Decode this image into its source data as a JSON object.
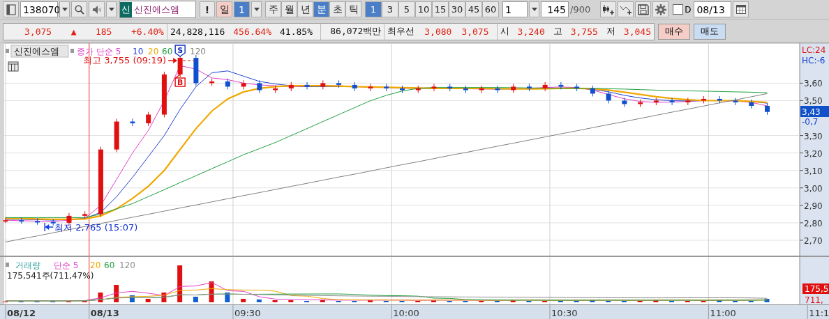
{
  "toolbar": {
    "code": "138070",
    "name_badge": "신",
    "name": "신진에스엠",
    "alert": "!",
    "day_button": {
      "label": "일",
      "active": true
    },
    "day_count": {
      "label": "1",
      "selected": true
    },
    "periods": [
      {
        "label": "주",
        "selected": false
      },
      {
        "label": "월",
        "selected": false
      },
      {
        "label": "년",
        "selected": false
      },
      {
        "label": "분",
        "selected": true
      },
      {
        "label": "초",
        "selected": false
      },
      {
        "label": "틱",
        "selected": false
      }
    ],
    "intervals": [
      {
        "label": "1",
        "selected": true
      },
      {
        "label": "3",
        "selected": false
      },
      {
        "label": "5",
        "selected": false
      },
      {
        "label": "10",
        "selected": false
      },
      {
        "label": "15",
        "selected": false
      },
      {
        "label": "30",
        "selected": false
      },
      {
        "label": "45",
        "selected": false
      },
      {
        "label": "60",
        "selected": false
      }
    ],
    "count_field": "1",
    "range_field": "145",
    "range_total": "/900",
    "checkbox": {
      "label": "D",
      "checked": false
    },
    "date": "08/13"
  },
  "quote": {
    "groups": [
      [
        {
          "text": "3,075",
          "kind": "up"
        },
        {
          "text": "▲",
          "kind": "up"
        },
        {
          "text": "185",
          "kind": "up"
        },
        {
          "text": "+6.40%",
          "kind": "up"
        }
      ],
      [
        {
          "text": "24,828,116",
          "kind": "plain"
        },
        {
          "text": "456.64%",
          "kind": "up"
        },
        {
          "text": "41.85%",
          "kind": "plain"
        }
      ],
      [
        {
          "text": "86,072백만",
          "kind": "plain"
        }
      ],
      [
        {
          "text": "최우선",
          "kind": "label"
        },
        {
          "text": "3,080",
          "kind": "up"
        },
        {
          "text": "3,075",
          "kind": "up"
        }
      ],
      [
        {
          "text": "시",
          "kind": "label"
        },
        {
          "text": "3,240",
          "kind": "up"
        },
        {
          "text": "고",
          "kind": "label"
        },
        {
          "text": "3,755",
          "kind": "up"
        },
        {
          "text": "저",
          "kind": "label"
        },
        {
          "text": "3,045",
          "kind": "up"
        }
      ]
    ],
    "buy": "매수",
    "sell": "매도"
  },
  "price_panel": {
    "title": "신진에스엠",
    "legend": [
      {
        "text": "종가 단순 5",
        "color": "#e040c8"
      },
      {
        "text": "10",
        "color": "#2040d0"
      },
      {
        "text": "20",
        "color": "#f0a800"
      },
      {
        "text": "60",
        "color": "#20a040"
      },
      {
        "text": "120",
        "color": "#808080"
      }
    ],
    "signals": [
      {
        "label": "S",
        "kind": "sell"
      },
      {
        "label": "B",
        "kind": "buy"
      }
    ],
    "annotations": [
      {
        "text": "최고 3,755 (09:19)",
        "kind": "high"
      },
      {
        "text": "최저 2,765 (15:07)",
        "kind": "low"
      }
    ],
    "axis_labels": [
      {
        "text": "LC:24",
        "kind": "lc"
      },
      {
        "text": "HC:-6",
        "kind": "hc"
      },
      {
        "text": "3,43",
        "kind": "current"
      },
      {
        "text": "-0,7",
        "kind": "change"
      }
    ],
    "y_axis": [
      "3,60",
      "3,50",
      "3,30",
      "3,20",
      "3,10",
      "3,00",
      "2,90",
      "2,80",
      "2,70"
    ]
  },
  "volume_panel": {
    "legend": [
      {
        "text": "거래량",
        "color": "#30a0a0"
      },
      {
        "text": "단순 5",
        "color": "#e040c8"
      },
      {
        "text": "20",
        "color": "#f0a800"
      },
      {
        "text": "60",
        "color": "#20a040"
      },
      {
        "text": "120",
        "color": "#909090"
      }
    ],
    "summary": "175,541주(711,47%)",
    "axis_box": "175,5",
    "axis_text": "711,"
  },
  "time_axis": [
    "08/12",
    "08/13",
    "09:30",
    "10:00",
    "10:30",
    "11:00",
    "11:1"
  ]
}
